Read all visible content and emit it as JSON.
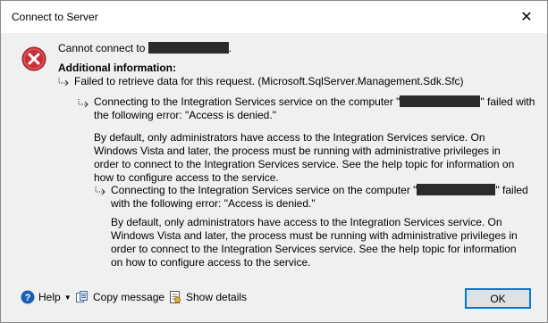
{
  "window": {
    "title": "Connect to Server",
    "close_glyph": "✕"
  },
  "message": {
    "cannot_connect_prefix": "Cannot connect to",
    "cannot_connect_suffix": ".",
    "additional_info_label": "Additional information:",
    "level1": "Failed to retrieve data for this request. (Microsoft.SqlServer.Management.Sdk.Sfc)",
    "level2": {
      "line1_prefix": "Connecting to the Integration Services service on the computer \"",
      "line1_suffix": "\" failed with",
      "line2": "the following error: \"Access is denied.\"",
      "paragraph": "By default, only administrators have access to the Integration Services service. On Windows Vista and later, the process must be running with administrative privileges in order to connect to the Integration Services service. See the help topic for information on how to configure access to the service."
    },
    "level3": {
      "line1_prefix": "Connecting to the Integration Services service on the computer \"",
      "line1_suffix": "\" failed",
      "line2": "with the following error: \"Access is denied.\"",
      "paragraph": "By default, only administrators have access to the Integration Services service. On Windows Vista and later, the process must be running with administrative privileges in order to connect to the Integration Services service. See the help topic for information on how to configure access to the service."
    }
  },
  "footer": {
    "help_label": "Help",
    "copy_label": "Copy message",
    "details_label": "Show details",
    "ok_label": "OK"
  },
  "icons": {
    "error": "error-icon",
    "help": "help-icon",
    "copy": "copy-icon",
    "details": "details-icon"
  },
  "colors": {
    "error_red": "#c8303a",
    "help_blue": "#1a5fb4",
    "focus_blue": "#0078d7"
  }
}
